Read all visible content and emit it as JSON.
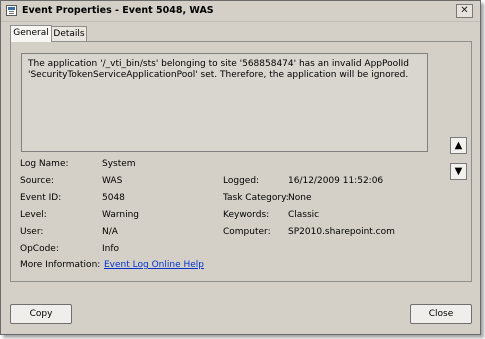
{
  "window": {
    "title": "Event Properties - Event 5048, WAS",
    "close_glyph": "✕"
  },
  "tabs": [
    {
      "label": "General"
    },
    {
      "label": "Details"
    }
  ],
  "description": "The application '/_vti_bin/sts' belonging to site '568858474' has an invalid AppPoolId 'SecurityTokenServiceApplicationPool' set.  Therefore, the application will be ignored.",
  "fields": {
    "log_name": {
      "label": "Log Name:",
      "value": "System"
    },
    "source": {
      "label": "Source:",
      "value": "WAS"
    },
    "logged": {
      "label": "Logged:",
      "value": "16/12/2009 11:52:06"
    },
    "event_id": {
      "label": "Event ID:",
      "value": "5048"
    },
    "task_category": {
      "label": "Task Category:",
      "value": "None"
    },
    "level": {
      "label": "Level:",
      "value": "Warning"
    },
    "keywords": {
      "label": "Keywords:",
      "value": "Classic"
    },
    "user": {
      "label": "User:",
      "value": "N/A"
    },
    "computer": {
      "label": "Computer:",
      "value": "SP2010.sharepoint.com"
    },
    "opcode": {
      "label": "OpCode:",
      "value": "Info"
    },
    "more_info": {
      "label": "More Information:",
      "link": "Event Log Online Help"
    }
  },
  "scroll": {
    "up_glyph": "▲",
    "down_glyph": "▼"
  },
  "buttons": {
    "copy": "Copy",
    "close": "Close"
  }
}
